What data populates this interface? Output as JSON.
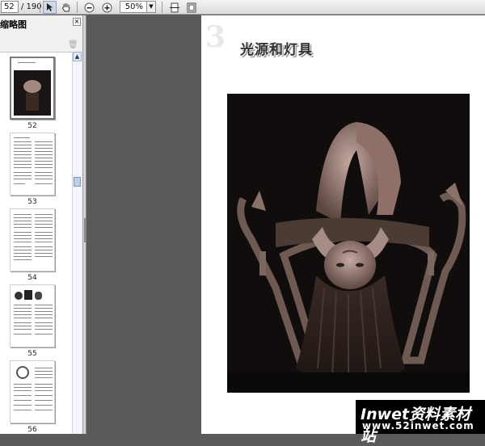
{
  "toolbar": {
    "current_page": "52",
    "page_total": "/ 190",
    "zoom_value": "50%"
  },
  "sidebar": {
    "title": "缩略图",
    "thumbnails": [
      {
        "label": "52"
      },
      {
        "label": "53"
      },
      {
        "label": "54"
      },
      {
        "label": "55"
      },
      {
        "label": "56"
      }
    ]
  },
  "page": {
    "chapter_number": "3",
    "chapter_title": "光源和灯具"
  },
  "watermark": {
    "brand": "Inwet资料素材站",
    "url": "www.52inwet.com"
  }
}
